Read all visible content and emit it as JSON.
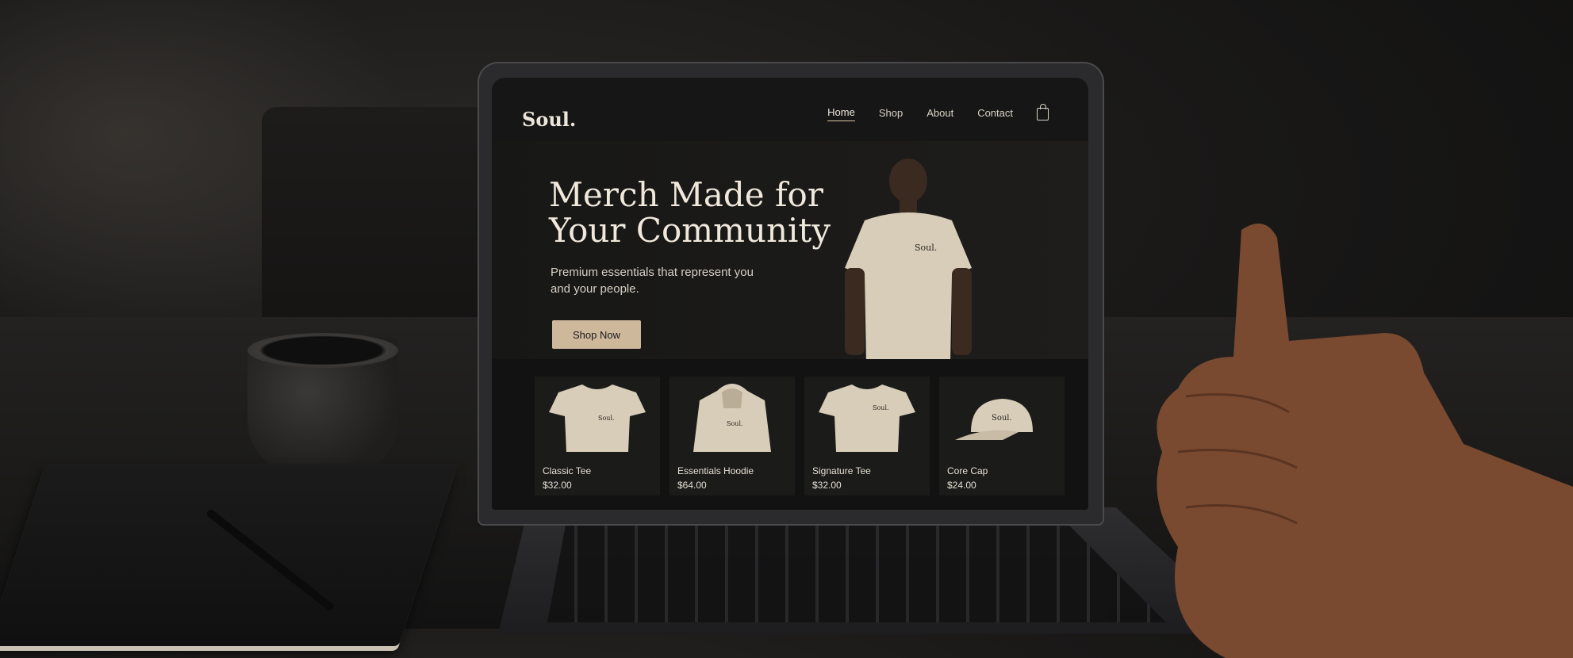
{
  "site": {
    "logo": "Soul.",
    "nav": [
      {
        "label": "Home",
        "active": true
      },
      {
        "label": "Shop",
        "active": false
      },
      {
        "label": "About",
        "active": false
      },
      {
        "label": "Contact",
        "active": false
      }
    ],
    "cart_icon": "shopping-bag-icon"
  },
  "hero": {
    "title": "Merch Made for Your Community",
    "subtitle": "Premium essentials that represent you and your people.",
    "cta_label": "Shop Now",
    "tee_logo": "Soul."
  },
  "products": [
    {
      "name": "Classic Tee",
      "price": "$32.00",
      "print": "Soul."
    },
    {
      "name": "Essentials Hoodie",
      "price": "$64.00",
      "print": "Soul."
    },
    {
      "name": "Signature Tee",
      "price": "$32.00",
      "print": "Soul."
    },
    {
      "name": "Core Cap",
      "price": "$24.00",
      "print": "Soul."
    }
  ],
  "colors": {
    "accent": "#cdb89c",
    "background": "#161616",
    "text": "#efe8db"
  }
}
